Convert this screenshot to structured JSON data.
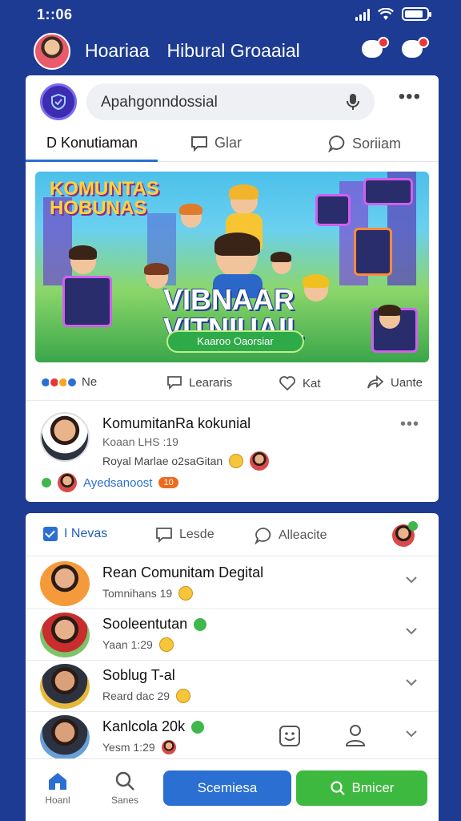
{
  "status_bar": {
    "time": "1::06"
  },
  "header": {
    "name_1": "Hoariaa",
    "name_2": "Hibural Groaaial"
  },
  "search": {
    "placeholder": "Apahgonndossial"
  },
  "top_tabs": [
    {
      "label": "D Konutiaman"
    },
    {
      "label": "Glar"
    },
    {
      "label": "Soriiam"
    }
  ],
  "banner": {
    "title_line1": "KOMUNTAS",
    "title_line2": "HOBUNAS",
    "big_line1": "VIBNAAR",
    "big_line2": "VITNIUAIL",
    "button": "Kaaroo Oaorsiar"
  },
  "actions": {
    "like_count": "Ne",
    "comment": "Leararis",
    "love": "Kat",
    "share": "Uante"
  },
  "post": {
    "name": "KomumitanRa kokunial",
    "sub1": "Koaan LHS :19",
    "sub2": "Royal Marlae o2saGitan",
    "tag": "Ayedsanoost",
    "badge": "10"
  },
  "section_tabs": [
    {
      "label": "I Nevas"
    },
    {
      "label": "Lesde"
    },
    {
      "label": "Alleacite"
    }
  ],
  "rows": [
    {
      "name": "Rean Comunitam Degital",
      "sub": "Tomnihans 19"
    },
    {
      "name": "Sooleentutan",
      "sub": "Yaan 1:29"
    },
    {
      "name": "Soblug T-al",
      "sub": "Reard dac 29"
    },
    {
      "name": "Kanlcola 20k",
      "sub": "Yesm 1:29"
    }
  ],
  "bottom_nav": {
    "home": "Hoanl",
    "search": "Sanes",
    "primary_button": "Scemiesa",
    "secondary_button": "Bmicer"
  },
  "colors": {
    "background": "#1d3b93",
    "accent_blue": "#2a6fd1",
    "accent_green": "#3db93f"
  }
}
